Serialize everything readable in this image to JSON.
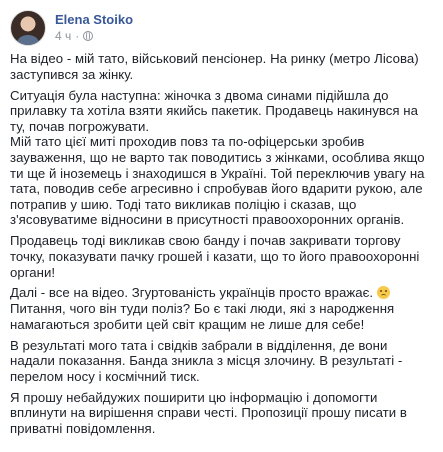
{
  "post": {
    "author": "Elena Stoiko",
    "time": "4 ч",
    "dot": "·",
    "privacy_icon": "globe-icon",
    "paragraphs": [
      "На відео - мій тато, військовий пенсіонер. На ринку (метро Лісова) заступився за жінку.",
      "Ситуація була наступна: жіночка з двома синами підійшла до прилавку та хотіла взяти якийсь пакетик. Продавець накинувся на ту, почав погрожувати.\nМій тато цієї миті проходив повз та по-офіцерськи зробив зауваження, що не варто так поводитись з жінками, особлива якщо ти ще й іноземець і знаходишся в Україні. Той переключив увагу на тата, поводив себе агресивно і спробував його вдарити рукою, але потрапив у шию. Тоді тато викликав поліцію і сказав, що з'ясовуватиме відносини в присутності правоохоронних органів.",
      "Продавець тоді викликав свою банду і почав закривати торгову точку, показувати пачку грошей і казати, що то його правоохоронні органи!",
      "Далі - все на відео. Згуртованість українців просто вражає.",
      "Питання, чого він туди поліз? Бо є такі люди, які з народження намагаються зробити цей світ кращим не лише для себе!",
      "В результаті мого тата і свідків забрали в відділення, де вони надали показання. Банда зникла з місця злочину. В результаті - перелом носу і космічний тиск.",
      "Я прошу небайдужих поширити цю інформацію і допомогти вплинути на вирішення справи честі. Пропозиції прошу писати в приватні повідомлення."
    ]
  }
}
